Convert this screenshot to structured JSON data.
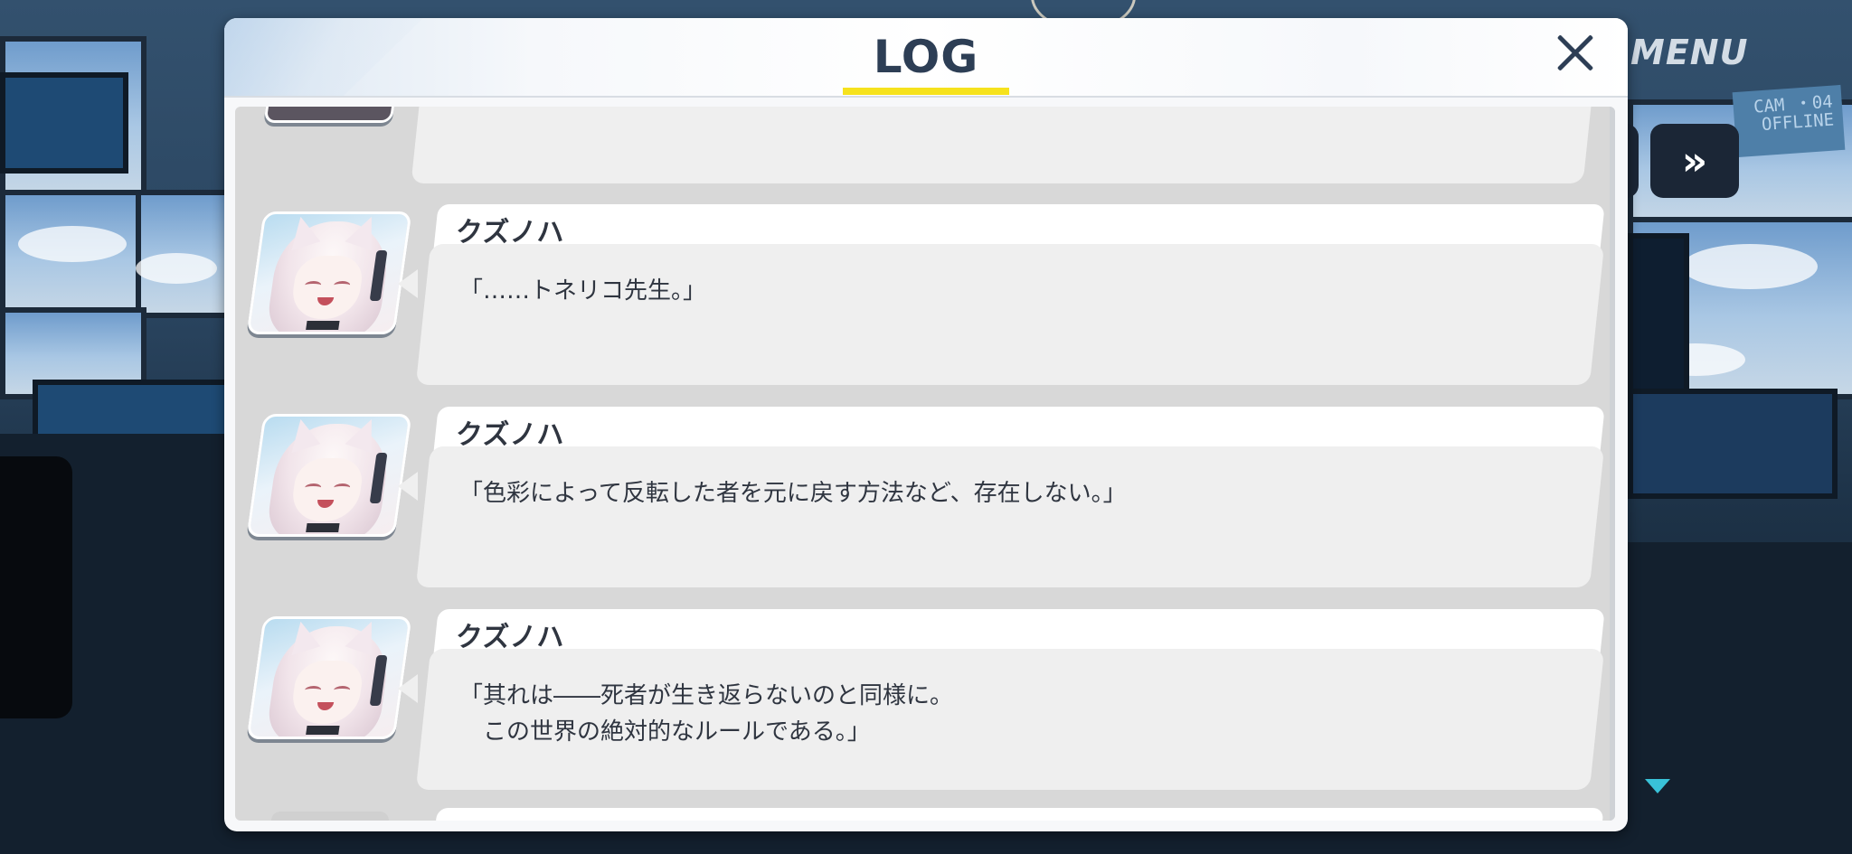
{
  "header": {
    "title": "LOG",
    "accent_color": "#f6e21d",
    "close_icon": "close-icon"
  },
  "overlay": {
    "menu_label": "MENU",
    "camera_label": "CAM ・04\nOFFLINE",
    "fast_forward_icon": "fast-forward-icon",
    "scroll_down_icon": "triangle-down-icon",
    "scroll_arrow_color": "#39c2d8"
  },
  "log": {
    "entries": [
      {
        "speaker": "クズノハ",
        "text": "「……トネリコ先生。」"
      },
      {
        "speaker": "クズノハ",
        "text": "「色彩によって反転した者を元に戻す方法など、存在しない。」"
      },
      {
        "speaker": "クズノハ",
        "text": "「其れは――死者が生き返らないのと同様に。\n　この世界の絶対的なルールである。」"
      }
    ]
  }
}
